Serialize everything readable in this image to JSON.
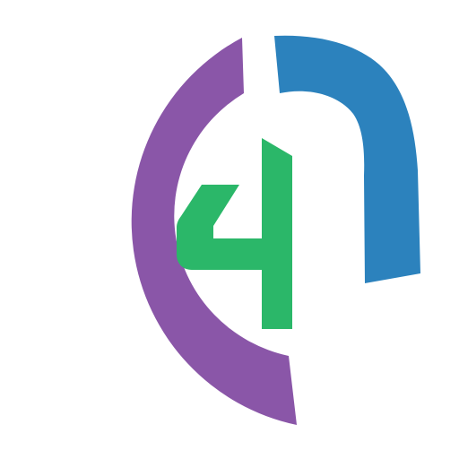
{
  "logo": {
    "name": "C4N logo mark",
    "colors": {
      "background": "#ffffff",
      "c_arc": "#8a56a8",
      "four": "#2bb769",
      "n_hook": "#2c82bd"
    }
  }
}
